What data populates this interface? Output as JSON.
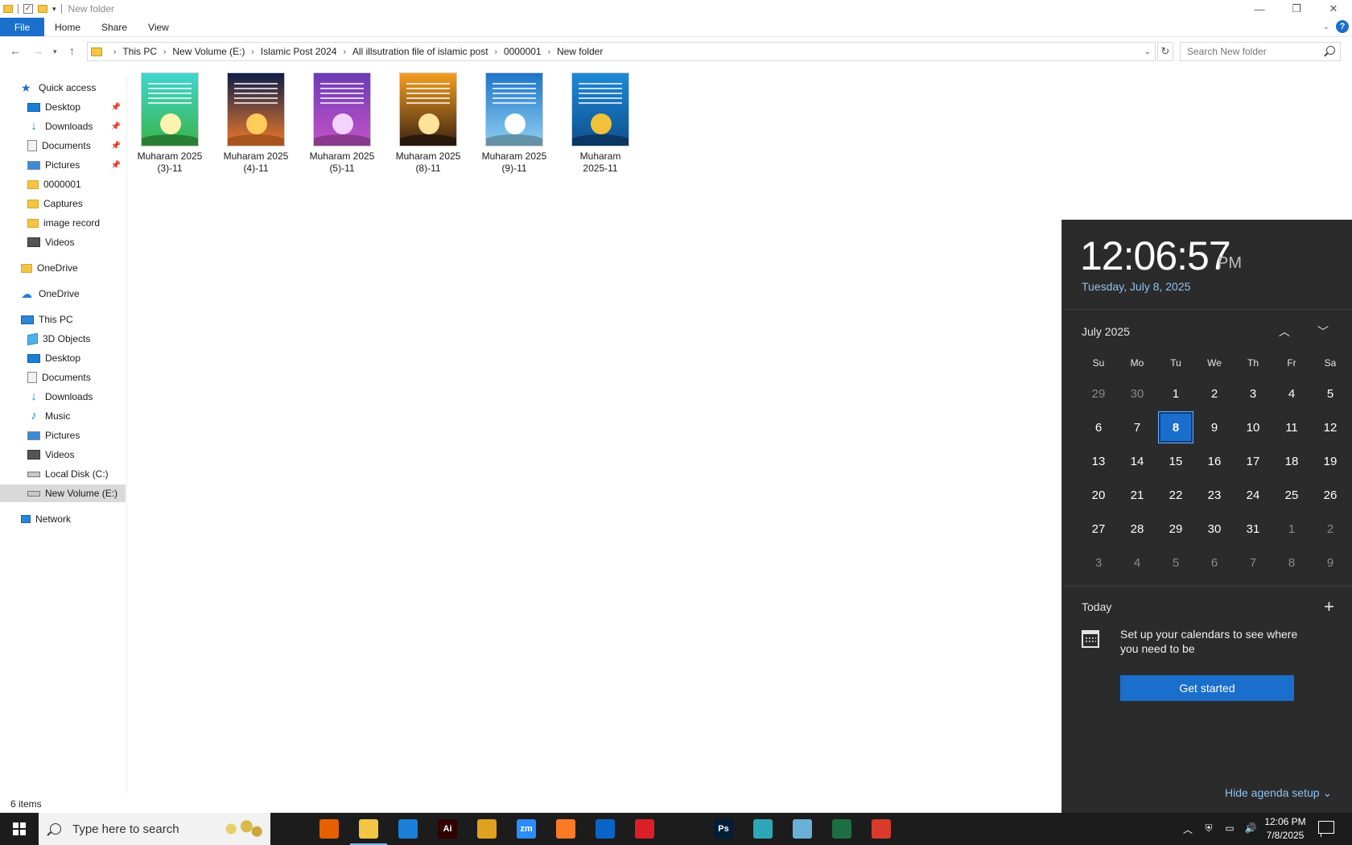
{
  "window": {
    "title": "New folder",
    "controls": [
      "minimize-icon",
      "restore-icon",
      "close-icon"
    ]
  },
  "ribbon": {
    "tabs": [
      "File",
      "Home",
      "Share",
      "View"
    ],
    "help_label": "?"
  },
  "address": {
    "crumbs": [
      "This PC",
      "New Volume (E:)",
      "Islamic Post 2024",
      "All illsutration file of islamic post",
      "0000001",
      "New folder"
    ],
    "search_placeholder": "Search New folder"
  },
  "nav": {
    "quick_access": "Quick access",
    "quick_items": [
      "Desktop",
      "Downloads",
      "Documents",
      "Pictures",
      "0000001",
      "Captures",
      "image record",
      "Videos"
    ],
    "onedrive_1": "OneDrive",
    "onedrive_2": "OneDrive",
    "this_pc": "This PC",
    "pc_items": [
      "3D Objects",
      "Desktop",
      "Documents",
      "Downloads",
      "Music",
      "Pictures",
      "Videos",
      "Local Disk (C:)",
      "New Volume (E:)"
    ],
    "network": "Network"
  },
  "files": [
    {
      "line1": "Muharam 2025",
      "line2": "(3)-11",
      "top": "#3fd6d0",
      "bottom": "#39b54a",
      "sun": "#fff4b0"
    },
    {
      "line1": "Muharam 2025",
      "line2": "(4)-11",
      "top": "#0d1d4a",
      "bottom": "#f07a2a",
      "sun": "#ffcb5a"
    },
    {
      "line1": "Muharam 2025",
      "line2": "(5)-11",
      "top": "#6b3bb5",
      "bottom": "#c453c9",
      "sun": "#f3d3ff"
    },
    {
      "line1": "Muharam 2025",
      "line2": "(8)-11",
      "top": "#f59e1f",
      "bottom": "#3a2212",
      "sun": "#ffe39a"
    },
    {
      "line1": "Muharam 2025",
      "line2": "(9)-11",
      "top": "#1e74c8",
      "bottom": "#8fd0f2",
      "sun": "#ffffff"
    },
    {
      "line1": "Muharam",
      "line2": "2025-11",
      "top": "#1d8ad8",
      "bottom": "#0f4f8f",
      "sun": "#f2c13a"
    }
  ],
  "status": {
    "items": "6 items"
  },
  "calendar": {
    "time": "12:06:57",
    "ampm": "PM",
    "date": "Tuesday, July 8, 2025",
    "month": "July 2025",
    "weekdays": [
      "Su",
      "Mo",
      "Tu",
      "We",
      "Th",
      "Fr",
      "Sa"
    ],
    "weeks": [
      [
        "29",
        "30",
        "1",
        "2",
        "3",
        "4",
        "5"
      ],
      [
        "6",
        "7",
        "8",
        "9",
        "10",
        "11",
        "12"
      ],
      [
        "13",
        "14",
        "15",
        "16",
        "17",
        "18",
        "19"
      ],
      [
        "20",
        "21",
        "22",
        "23",
        "24",
        "25",
        "26"
      ],
      [
        "27",
        "28",
        "29",
        "30",
        "31",
        "1",
        "2"
      ],
      [
        "3",
        "4",
        "5",
        "6",
        "7",
        "8",
        "9"
      ]
    ],
    "selected_day": "8",
    "today_label": "Today",
    "setup_text": "Set up your calendars to see where you need to be",
    "get_started": "Get started",
    "hide_agenda": "Hide agenda setup",
    "accent_color": "#1a6ecc"
  },
  "taskbar": {
    "search_placeholder": "Type here to search",
    "apps": [
      {
        "name": "task-view",
        "label": "",
        "color": "#1c1c1c"
      },
      {
        "name": "firefox",
        "label": "",
        "color": "#e66000"
      },
      {
        "name": "file-explorer",
        "label": "",
        "color": "#f3c545"
      },
      {
        "name": "vscode",
        "label": "",
        "color": "#1a7fd9"
      },
      {
        "name": "illustrator",
        "label": "Ai",
        "color": "#300000"
      },
      {
        "name": "chrome",
        "label": "",
        "color": "#e0a020"
      },
      {
        "name": "zoom",
        "label": "zm",
        "color": "#2d8cff"
      },
      {
        "name": "xampp",
        "label": "",
        "color": "#fb7a24"
      },
      {
        "name": "outlook",
        "label": "",
        "color": "#0a64c8"
      },
      {
        "name": "creative-cloud",
        "label": "",
        "color": "#da1f26"
      },
      {
        "name": "pen-tool",
        "label": "",
        "color": "#1c1c1c"
      },
      {
        "name": "photoshop",
        "label": "Ps",
        "color": "#001e36"
      },
      {
        "name": "app-diamond",
        "label": "",
        "color": "#2ca7b8"
      },
      {
        "name": "app-notepad",
        "label": "",
        "color": "#6ab0d6"
      },
      {
        "name": "excel",
        "label": "",
        "color": "#1d6f42"
      },
      {
        "name": "snipping-tool",
        "label": "",
        "color": "#d83b2a"
      }
    ],
    "time": "12:06 PM",
    "date": "7/8/2025"
  }
}
